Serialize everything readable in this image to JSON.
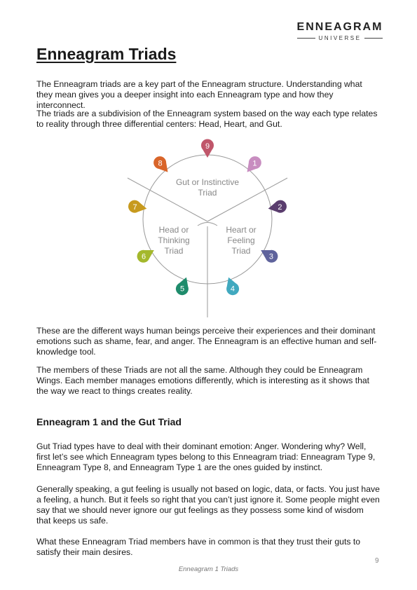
{
  "logo": {
    "main": "ENNEAGRAM",
    "sub": "UNIVERSE"
  },
  "title": "Enneagram Triads",
  "intro": [
    "The Enneagram triads are a key part of the Enneagram structure. Understanding what they mean gives you a deeper insight into each Enneagram type and how they interconnect.",
    "The triads are a subdivision of the Enneagram system based on the way each type relates to reality through three differential centers: Head, Heart, and Gut."
  ],
  "diagram": {
    "triads": {
      "gut": [
        "Gut or Instinctive",
        "Triad"
      ],
      "head": [
        "Head or",
        "Thinking",
        "Triad"
      ],
      "heart": [
        "Heart or",
        "Feeling",
        "Triad"
      ]
    },
    "points": [
      {
        "label": "9",
        "color": "#c0566a"
      },
      {
        "label": "1",
        "color": "#c88dc0"
      },
      {
        "label": "2",
        "color": "#5a3d6e"
      },
      {
        "label": "3",
        "color": "#5f639c"
      },
      {
        "label": "4",
        "color": "#41a9bf"
      },
      {
        "label": "5",
        "color": "#1f8c6c"
      },
      {
        "label": "6",
        "color": "#a4b82c"
      },
      {
        "label": "7",
        "color": "#c79a1e"
      },
      {
        "label": "8",
        "color": "#d9652a"
      }
    ]
  },
  "body": [
    "These are the different ways human beings perceive their experiences and their dominant emotions such as shame, fear, and anger. The Enneagram is an effective human and self-knowledge tool.",
    "The members of these Triads are not all the same. Although they could be Enneagram Wings. Each member manages emotions differently, which is interesting as it shows that the way we react to things creates reality."
  ],
  "section_title": "Enneagram 1 and the Gut Triad",
  "section_body": [
    "Gut Triad types have to deal with their dominant emotion: Anger. Wondering why? Well, first let’s see which Enneagram types belong to this Enneagram triad: Enneagram Type 9, Enneagram Type 8, and Enneagram Type 1 are the ones guided by instinct.",
    "Generally speaking, a gut feeling is usually not based on logic, data, or facts. You just have a feeling, a hunch. But it feels so right that you can’t just ignore it. Some people might even say that we should never ignore our gut feelings as they possess some kind of wisdom that keeps us safe.",
    "What these Enneagram Triad members have in common is that they trust their guts to satisfy their main desires."
  ],
  "page_number": "9",
  "footer": "Enneagram 1 Triads"
}
